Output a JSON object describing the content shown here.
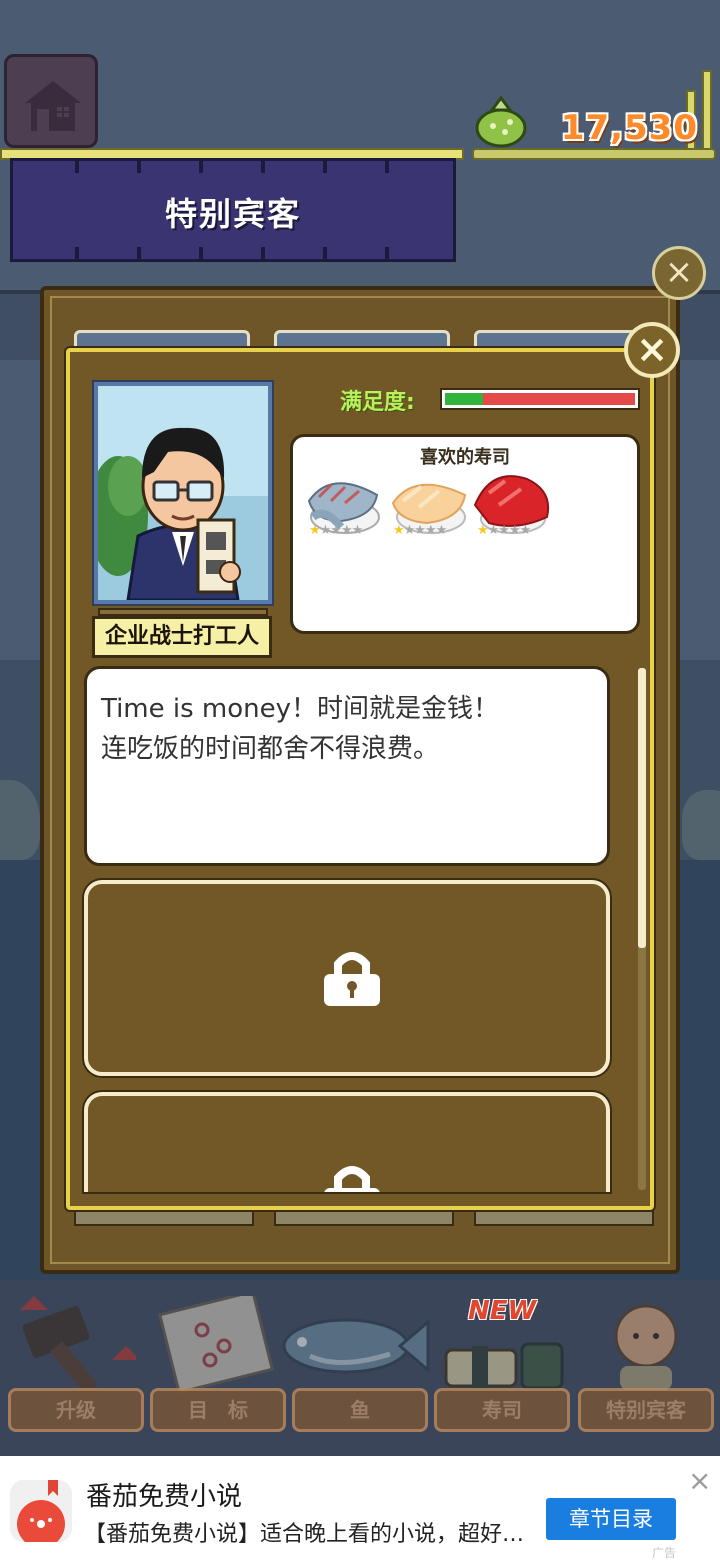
{
  "header": {
    "banner_title": "特别宾客",
    "money": "17,530",
    "home_icon": "house-icon",
    "money_icon": "money-bag-icon"
  },
  "guest": {
    "name": "企业战士打工人",
    "satisfaction_label": "满足度:",
    "satisfaction_level": 0.2,
    "favorite_title": "喜欢的寿司",
    "favorites": [
      {
        "name": "saba-nigiri-icon",
        "stars_on": 1,
        "stars_total": 5
      },
      {
        "name": "tamago-nigiri-icon",
        "stars_on": 1,
        "stars_total": 5
      },
      {
        "name": "maguro-nigiri-icon",
        "stars_on": 1,
        "stars_total": 5
      }
    ],
    "dialogue_line1": "Time is money！时间就是金钱！",
    "dialogue_line2": "连吃饭的时间都舍不得浪费。"
  },
  "colors": {
    "accent_gold": "#e8d24c",
    "panel_brown": "#735827",
    "banner_navy": "#3a3572",
    "money_orange": "#ff8a2a",
    "satisfaction_green": "#31b43c",
    "satisfaction_red": "#e44a4a"
  },
  "nav": {
    "upgrade": "升级",
    "goals": "目　标",
    "fish": "鱼",
    "sushi": "寿司",
    "special_guest": "特别宾客",
    "new_badge": "NEW"
  },
  "ad": {
    "app_name": "番茄免费小说",
    "description": "【番茄免费小说】适合晚上看的小说，超好看的小说免费读",
    "cta": "章节目录",
    "close": "×",
    "tag": "广告"
  }
}
